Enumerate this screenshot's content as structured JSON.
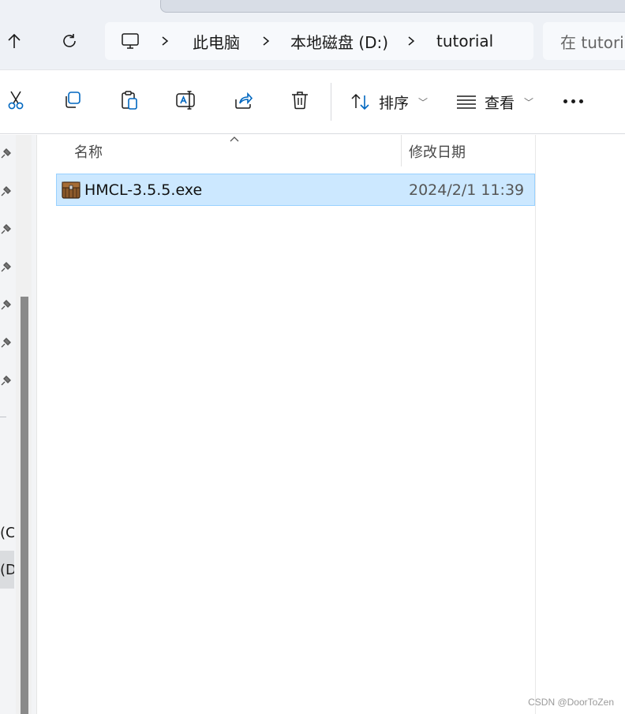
{
  "address_bar": {
    "breadcrumbs": [
      "此电脑",
      "本地磁盘 (D:)",
      "tutorial"
    ],
    "search_placeholder": "在 tutorial"
  },
  "command_bar": {
    "sort_label": "排序",
    "view_label": "查看"
  },
  "nav_pane": {
    "drive_c_label": "(C",
    "drive_d_label": "(D"
  },
  "file_list": {
    "columns": [
      "名称",
      "修改日期"
    ],
    "rows": [
      {
        "name": "HMCL-3.5.5.exe",
        "modified": "2024/2/1 11:39",
        "icon": "minecraft-chest-icon"
      }
    ]
  },
  "watermark": "CSDN @DoorToZen",
  "colors": {
    "selection_fill": "#cce8ff",
    "selection_border": "#99d1ff",
    "accent_blue": "#0067c0"
  }
}
